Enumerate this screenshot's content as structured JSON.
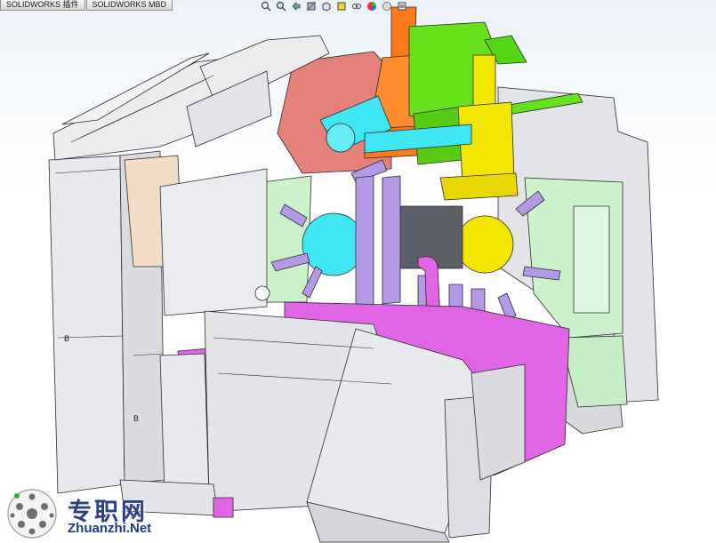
{
  "tabs": [
    {
      "label": "SOLIDWORKS 插件"
    },
    {
      "label": "SOLIDWORKS MBD"
    }
  ],
  "view_toolbar": {
    "buttons": [
      "zoom-to-fit-icon",
      "zoom-area-icon",
      "previous-view-icon",
      "section-view-icon",
      "view-orientation-icon",
      "display-style-icon",
      "hide-show-icon",
      "edit-appearance-icon",
      "scene-icon",
      "view-settings-icon"
    ]
  },
  "canvas": {
    "part_label_left": "B",
    "part_label_lower": "B"
  },
  "watermark": {
    "cn": "专职网",
    "en": "Zhuanzhi.Net"
  },
  "colors": {
    "outline": "#2a2a2a",
    "grey_panel": "#e3e4e8",
    "orange": "#ff7a1a",
    "green": "#66e01a",
    "yellow": "#f2e600",
    "cyan": "#40e6f2",
    "magenta": "#e066e6",
    "purple": "#b399e6",
    "salmon": "#e6807a",
    "mint": "#ccf2cc",
    "blue": "#1f3f9a"
  }
}
